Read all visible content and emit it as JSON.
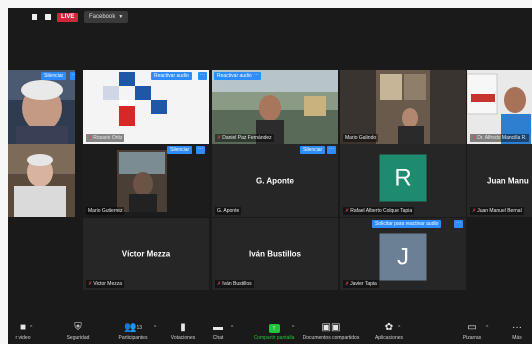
{
  "topbar": {
    "live_badge": "LIVE",
    "stream_target": "Facebook"
  },
  "tiles": [
    {
      "id": "t1",
      "name": "",
      "mic_muted": false,
      "overlay_label": "Silenciar",
      "show_more": true
    },
    {
      "id": "t2",
      "name": "Rosario Ortiz",
      "mic_muted": true,
      "overlay_label": "Reactivar audio",
      "show_more": true
    },
    {
      "id": "t3",
      "name": "Daniel Paz Fernández",
      "mic_muted": true,
      "overlay_label": "Reactivar audio",
      "show_more": true
    },
    {
      "id": "t4",
      "name": "Mario Galindo",
      "mic_muted": false,
      "overlay_label": "",
      "show_more": false
    },
    {
      "id": "t5",
      "name": "Dr. Alfredo Mancilla R.",
      "mic_muted": true,
      "overlay_label": "",
      "show_more": false
    },
    {
      "id": "t6",
      "name": "",
      "mic_muted": false,
      "overlay_label": "",
      "show_more": false
    },
    {
      "id": "t7",
      "name": "Mario Gutierrez",
      "mic_muted": false,
      "overlay_label": "Silenciar",
      "show_more": true,
      "active_speaker": true
    },
    {
      "id": "t8",
      "name": "G. Aponte",
      "display_name": "G. Aponte",
      "mic_muted": false,
      "overlay_label": "Silenciar",
      "show_more": true
    },
    {
      "id": "t9",
      "name": "Rafael Alberto Colque Tapia",
      "mic_muted": true,
      "avatar_letter": "R",
      "avatar_color": "#1e8a6e"
    },
    {
      "id": "t10",
      "name": "Juan Manuel Bernal",
      "display_name": "Juan Manu",
      "mic_muted": true
    },
    {
      "id": "t11",
      "name": "Victor Mezza",
      "display_name": "Víctor Mezza",
      "mic_muted": true
    },
    {
      "id": "t12",
      "name": "Iván Bustillos",
      "display_name": "Iván Bustillos",
      "mic_muted": true
    },
    {
      "id": "t13",
      "name": "Javier Tapia",
      "mic_muted": true,
      "overlay_label": "Solicitar para reactivar audio",
      "show_more": true,
      "avatar_letter": "J",
      "avatar_color": "#6b8094"
    }
  ],
  "toolbar": {
    "items": [
      {
        "label": "r video",
        "icon": "video-icon"
      },
      {
        "label": "Seguridad",
        "icon": "shield-icon"
      },
      {
        "label": "Participantes",
        "icon": "participants-icon",
        "count": "13"
      },
      {
        "label": "Votaciones",
        "icon": "poll-icon"
      },
      {
        "label": "Chat",
        "icon": "chat-icon"
      },
      {
        "label": "Compartir pantalla",
        "icon": "share-screen-icon"
      },
      {
        "label": "Documentos compartidos",
        "icon": "documents-icon"
      },
      {
        "label": "Aplicaciones",
        "icon": "apps-icon"
      },
      {
        "label": "Pizarras",
        "icon": "whiteboard-icon"
      },
      {
        "label": "Más",
        "icon": "more-icon"
      }
    ]
  },
  "colors": {
    "accent": "#2d8cff",
    "active_border": "#c9d44a",
    "share_green": "#23c33b",
    "live_red": "#d0283a"
  }
}
